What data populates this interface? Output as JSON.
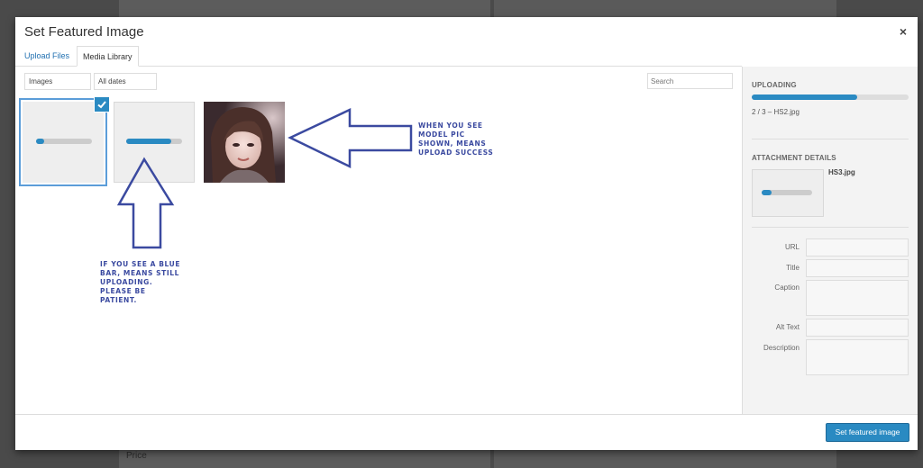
{
  "background": {
    "price_label": "Price"
  },
  "modal": {
    "title": "Set Featured Image",
    "close_label": "×",
    "tabs": [
      {
        "label": "Upload Files",
        "active": false
      },
      {
        "label": "Media Library",
        "active": true
      }
    ]
  },
  "toolbar": {
    "type_filter": "Images",
    "date_filter": "All dates",
    "search_placeholder": "Search"
  },
  "attachments": [
    {
      "kind": "uploading",
      "progress": 0.15,
      "selected": true
    },
    {
      "kind": "uploading",
      "progress": 0.8,
      "selected": false
    },
    {
      "kind": "image",
      "selected": false
    }
  ],
  "annotations": {
    "right": [
      "WHEN YOU SEE",
      "MODEL PIC",
      "SHOWN, MEANS",
      "UPLOAD SUCCESS"
    ],
    "left": [
      "IF YOU SEE A BLUE",
      "BAR, MEANS STILL",
      "UPLOADING.",
      "PLEASE BE",
      "PATIENT."
    ],
    "arrow_color": "#3b4aa0"
  },
  "sidebar": {
    "uploading_heading": "UPLOADING",
    "upload_progress": 0.67,
    "upload_status": "2 / 3  –  HS2.jpg",
    "details_heading": "ATTACHMENT DETAILS",
    "detail_filename": "HS3.jpg",
    "detail_progress": 0.2,
    "fields": {
      "url": "URL",
      "title": "Title",
      "caption": "Caption",
      "alt": "Alt Text",
      "description": "Description"
    }
  },
  "footer": {
    "primary_button": "Set featured image"
  },
  "colors": {
    "accent": "#2a8ac2",
    "link": "#2271b1",
    "annotation": "#3b4aa0"
  }
}
